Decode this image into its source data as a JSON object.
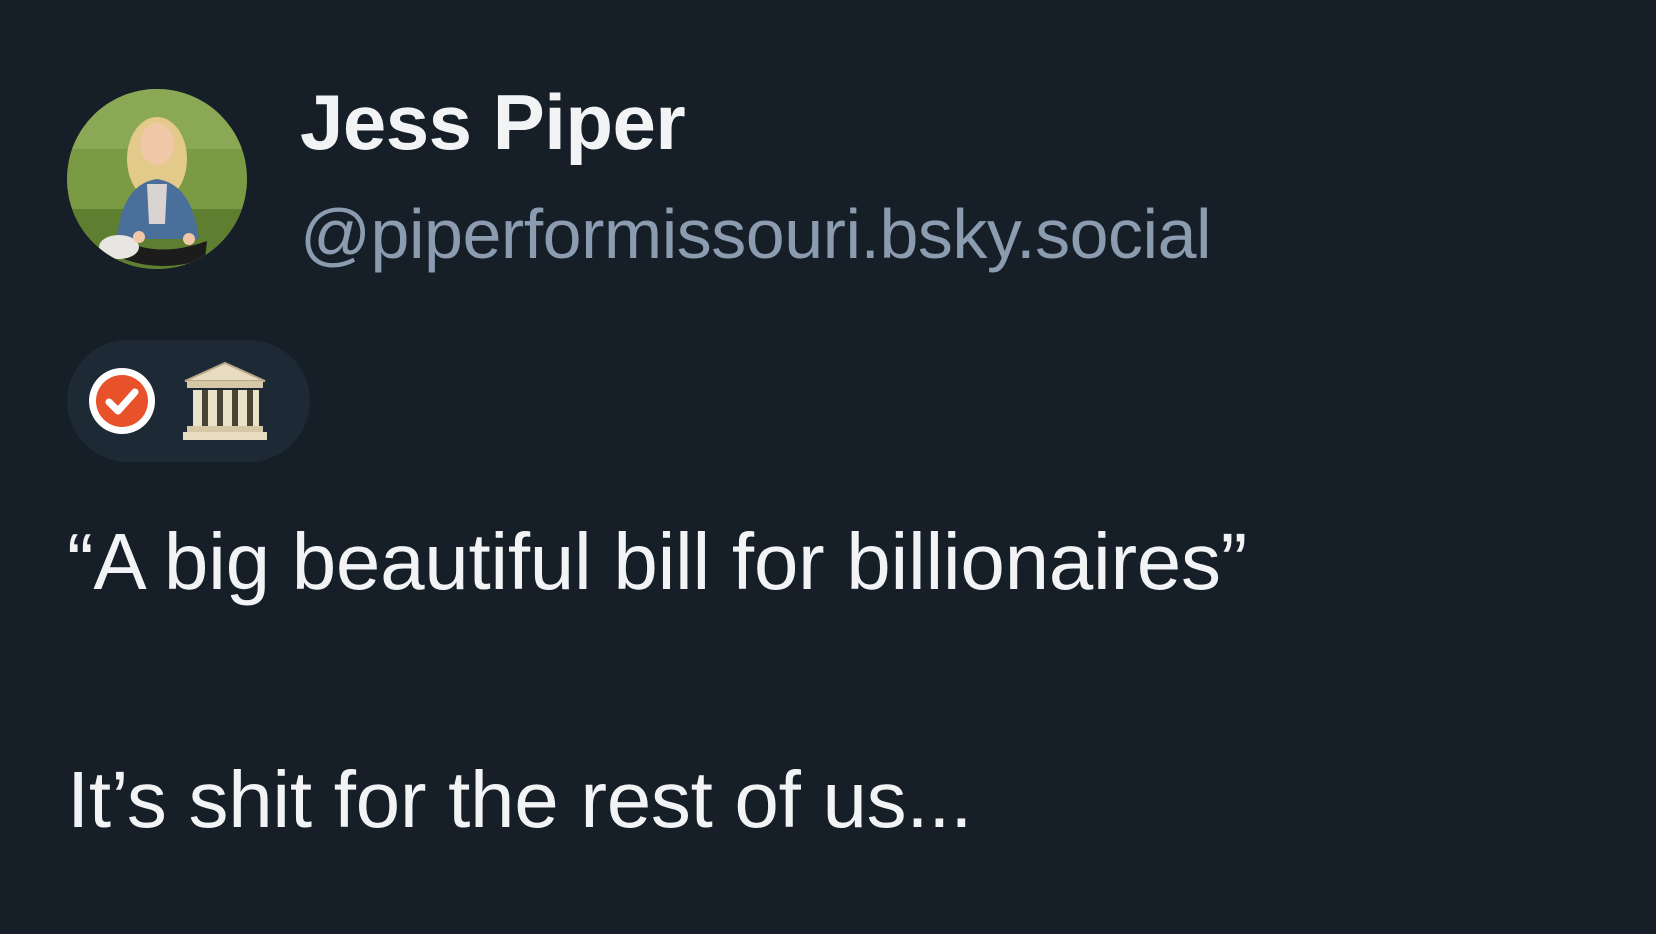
{
  "author": {
    "display_name": "Jess Piper",
    "handle": "@piperformissouri.bsky.social",
    "avatar_icon": "avatar-photo"
  },
  "badges": {
    "verified_icon": "verified-check-icon",
    "verified_color": "#e8522b",
    "government_icon": "classical-building-icon"
  },
  "post": {
    "line1": "“A big beautiful bill for billionaires”",
    "line2": "It’s shit for the rest of us..."
  },
  "colors": {
    "background": "#161e27",
    "text_primary": "#f1f3f5",
    "text_secondary": "#8b9bb0",
    "badge_pill": "#1e2936"
  }
}
